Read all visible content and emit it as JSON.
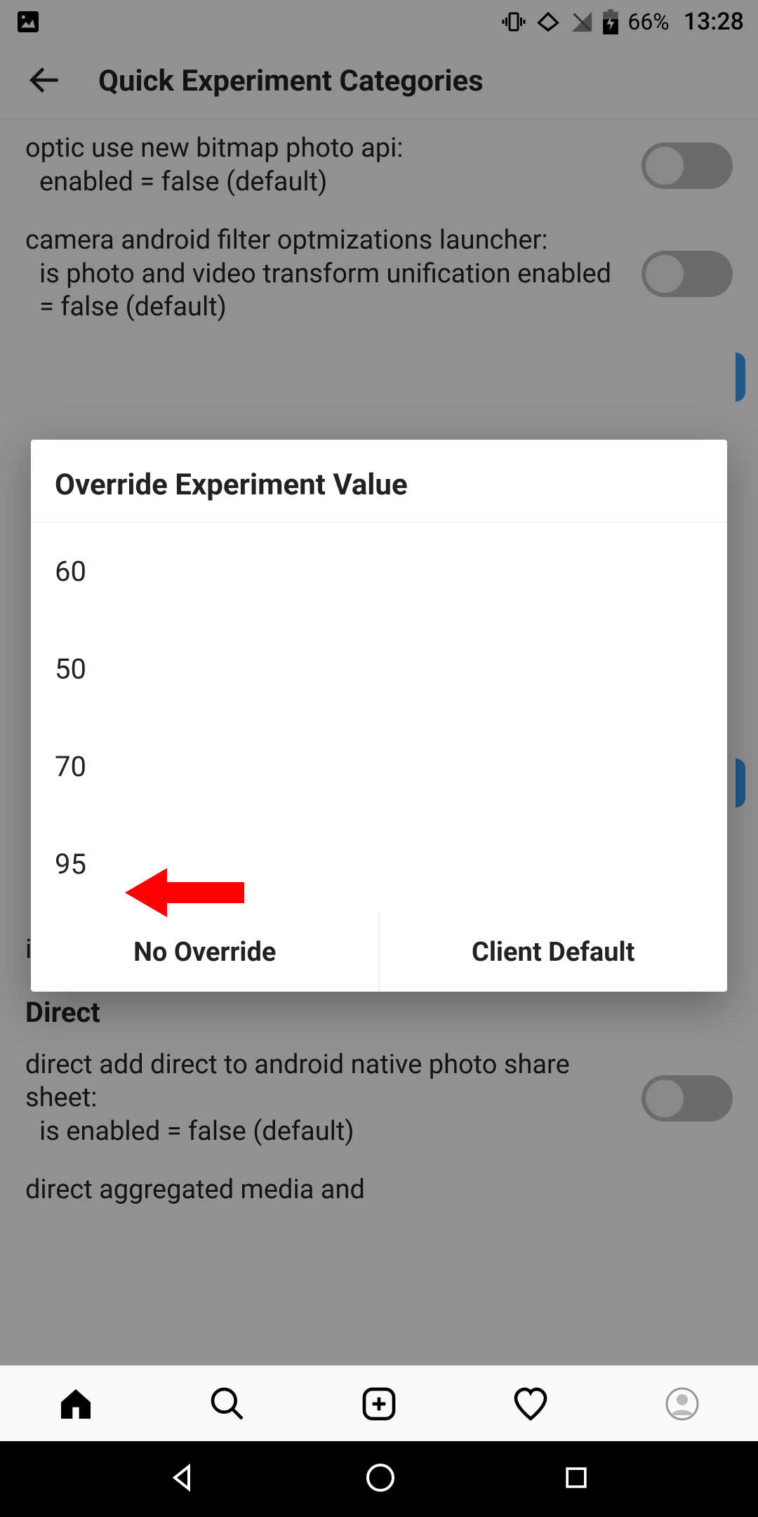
{
  "status": {
    "battery": "66%",
    "clock": "13:28"
  },
  "header": {
    "title": "Quick Experiment Categories"
  },
  "settings": {
    "rows": [
      {
        "line1": "optic use new bitmap photo api:",
        "line2": "enabled = false (default)"
      },
      {
        "line1": "camera android filter optmizations launcher:",
        "line2": "is photo and video transform unification enabled = false (default)"
      }
    ],
    "cutoff_line": "is enabled = false (default)",
    "section2_title": "Direct",
    "direct_row1_line1": "direct add direct to android native photo share sheet:",
    "direct_row1_line2": "is enabled = false (default)",
    "direct_row2_line1": "direct aggregated media and"
  },
  "dialog": {
    "title": "Override Experiment Value",
    "options": [
      "60",
      "50",
      "70",
      "95"
    ],
    "action_left": "No Override",
    "action_right": "Client Default"
  }
}
